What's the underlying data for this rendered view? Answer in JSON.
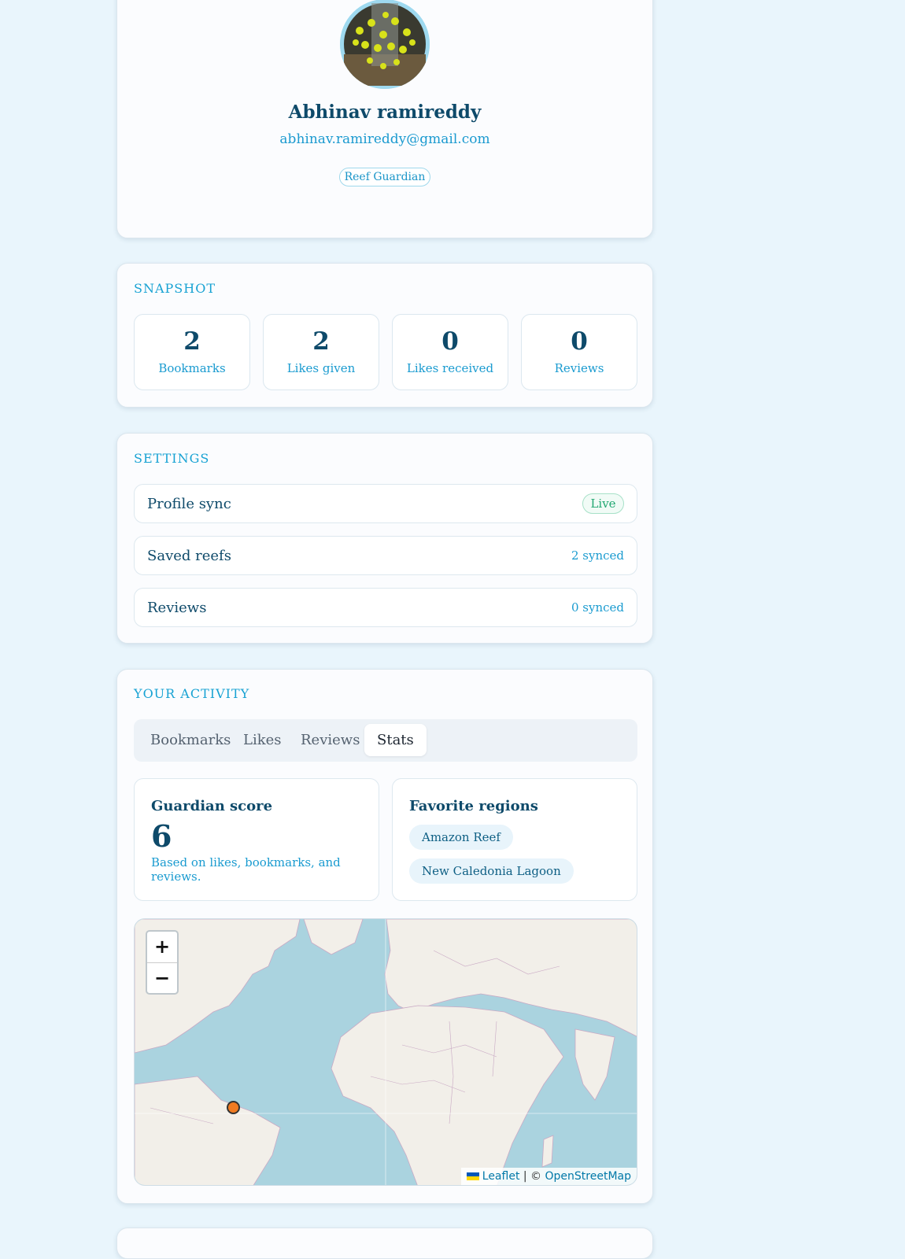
{
  "profile": {
    "name": "Abhinav ramireddy",
    "email": "abhinav.ramireddy@gmail.com",
    "role": "Reef Guardian",
    "avatar_icon": "avatar-photo"
  },
  "snapshot": {
    "title": "SNAPSHOT",
    "stats": [
      {
        "value": "2",
        "label": "Bookmarks"
      },
      {
        "value": "2",
        "label": "Likes given"
      },
      {
        "value": "0",
        "label": "Likes received"
      },
      {
        "value": "0",
        "label": "Reviews"
      }
    ]
  },
  "settings": {
    "title": "SETTINGS",
    "rows": [
      {
        "label": "Profile sync",
        "value": "Live"
      },
      {
        "label": "Saved reefs",
        "value": "2 synced"
      },
      {
        "label": "Reviews",
        "value": "0 synced"
      }
    ]
  },
  "activity": {
    "title": "YOUR ACTIVITY",
    "tabs": [
      "Bookmarks",
      "Likes",
      "Reviews",
      "Stats"
    ],
    "active_tab": "Stats",
    "guardian": {
      "heading": "Guardian score",
      "score": "6",
      "note": "Based on likes, bookmarks, and reviews."
    },
    "regions": {
      "heading": "Favorite regions",
      "items": [
        "Amazon Reef",
        "New Caledonia Lagoon"
      ]
    },
    "map": {
      "zoom_in": "+",
      "zoom_out": "−",
      "attribution_leaflet": "Leaflet",
      "attribution_sep": "| ©",
      "attribution_osm": "OpenStreetMap",
      "marker_color": "#f07b22"
    }
  },
  "colors": {
    "accent": "#17a2d3",
    "heading": "#0e4a6a",
    "live": "#22a872"
  }
}
